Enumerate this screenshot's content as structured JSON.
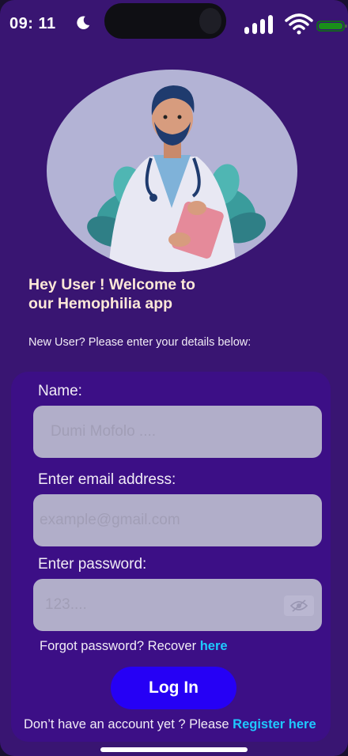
{
  "status_bar": {
    "time": "09: 11",
    "icons": [
      "moon-icon",
      "signal-icon",
      "wifi-icon",
      "battery-icon"
    ]
  },
  "illustration": {
    "subject": "doctor-illustration"
  },
  "welcome": {
    "title_line1": "Hey User ! Welcome to",
    "title_line2": "our Hemophilia app",
    "subtitle": "New User? Please enter your details below:"
  },
  "form": {
    "name_label": "Name:",
    "name_placeholder": "Dumi Mofolo ....",
    "email_label": "Enter email address:",
    "email_placeholder": "example@gmail.com",
    "password_label": "Enter password:",
    "password_placeholder": "123....",
    "forgot_text": "Forgot password? Recover ",
    "forgot_link": "here",
    "login_label": "Log In",
    "register_text": "Don’t have an account yet ? Please ",
    "register_link": "Register here"
  },
  "colors": {
    "background": "#391572",
    "card": "#3c0f86",
    "input": "#b1aec9",
    "button": "#2600f5",
    "link": "#1ec9ff",
    "title": "#fde8d8"
  }
}
